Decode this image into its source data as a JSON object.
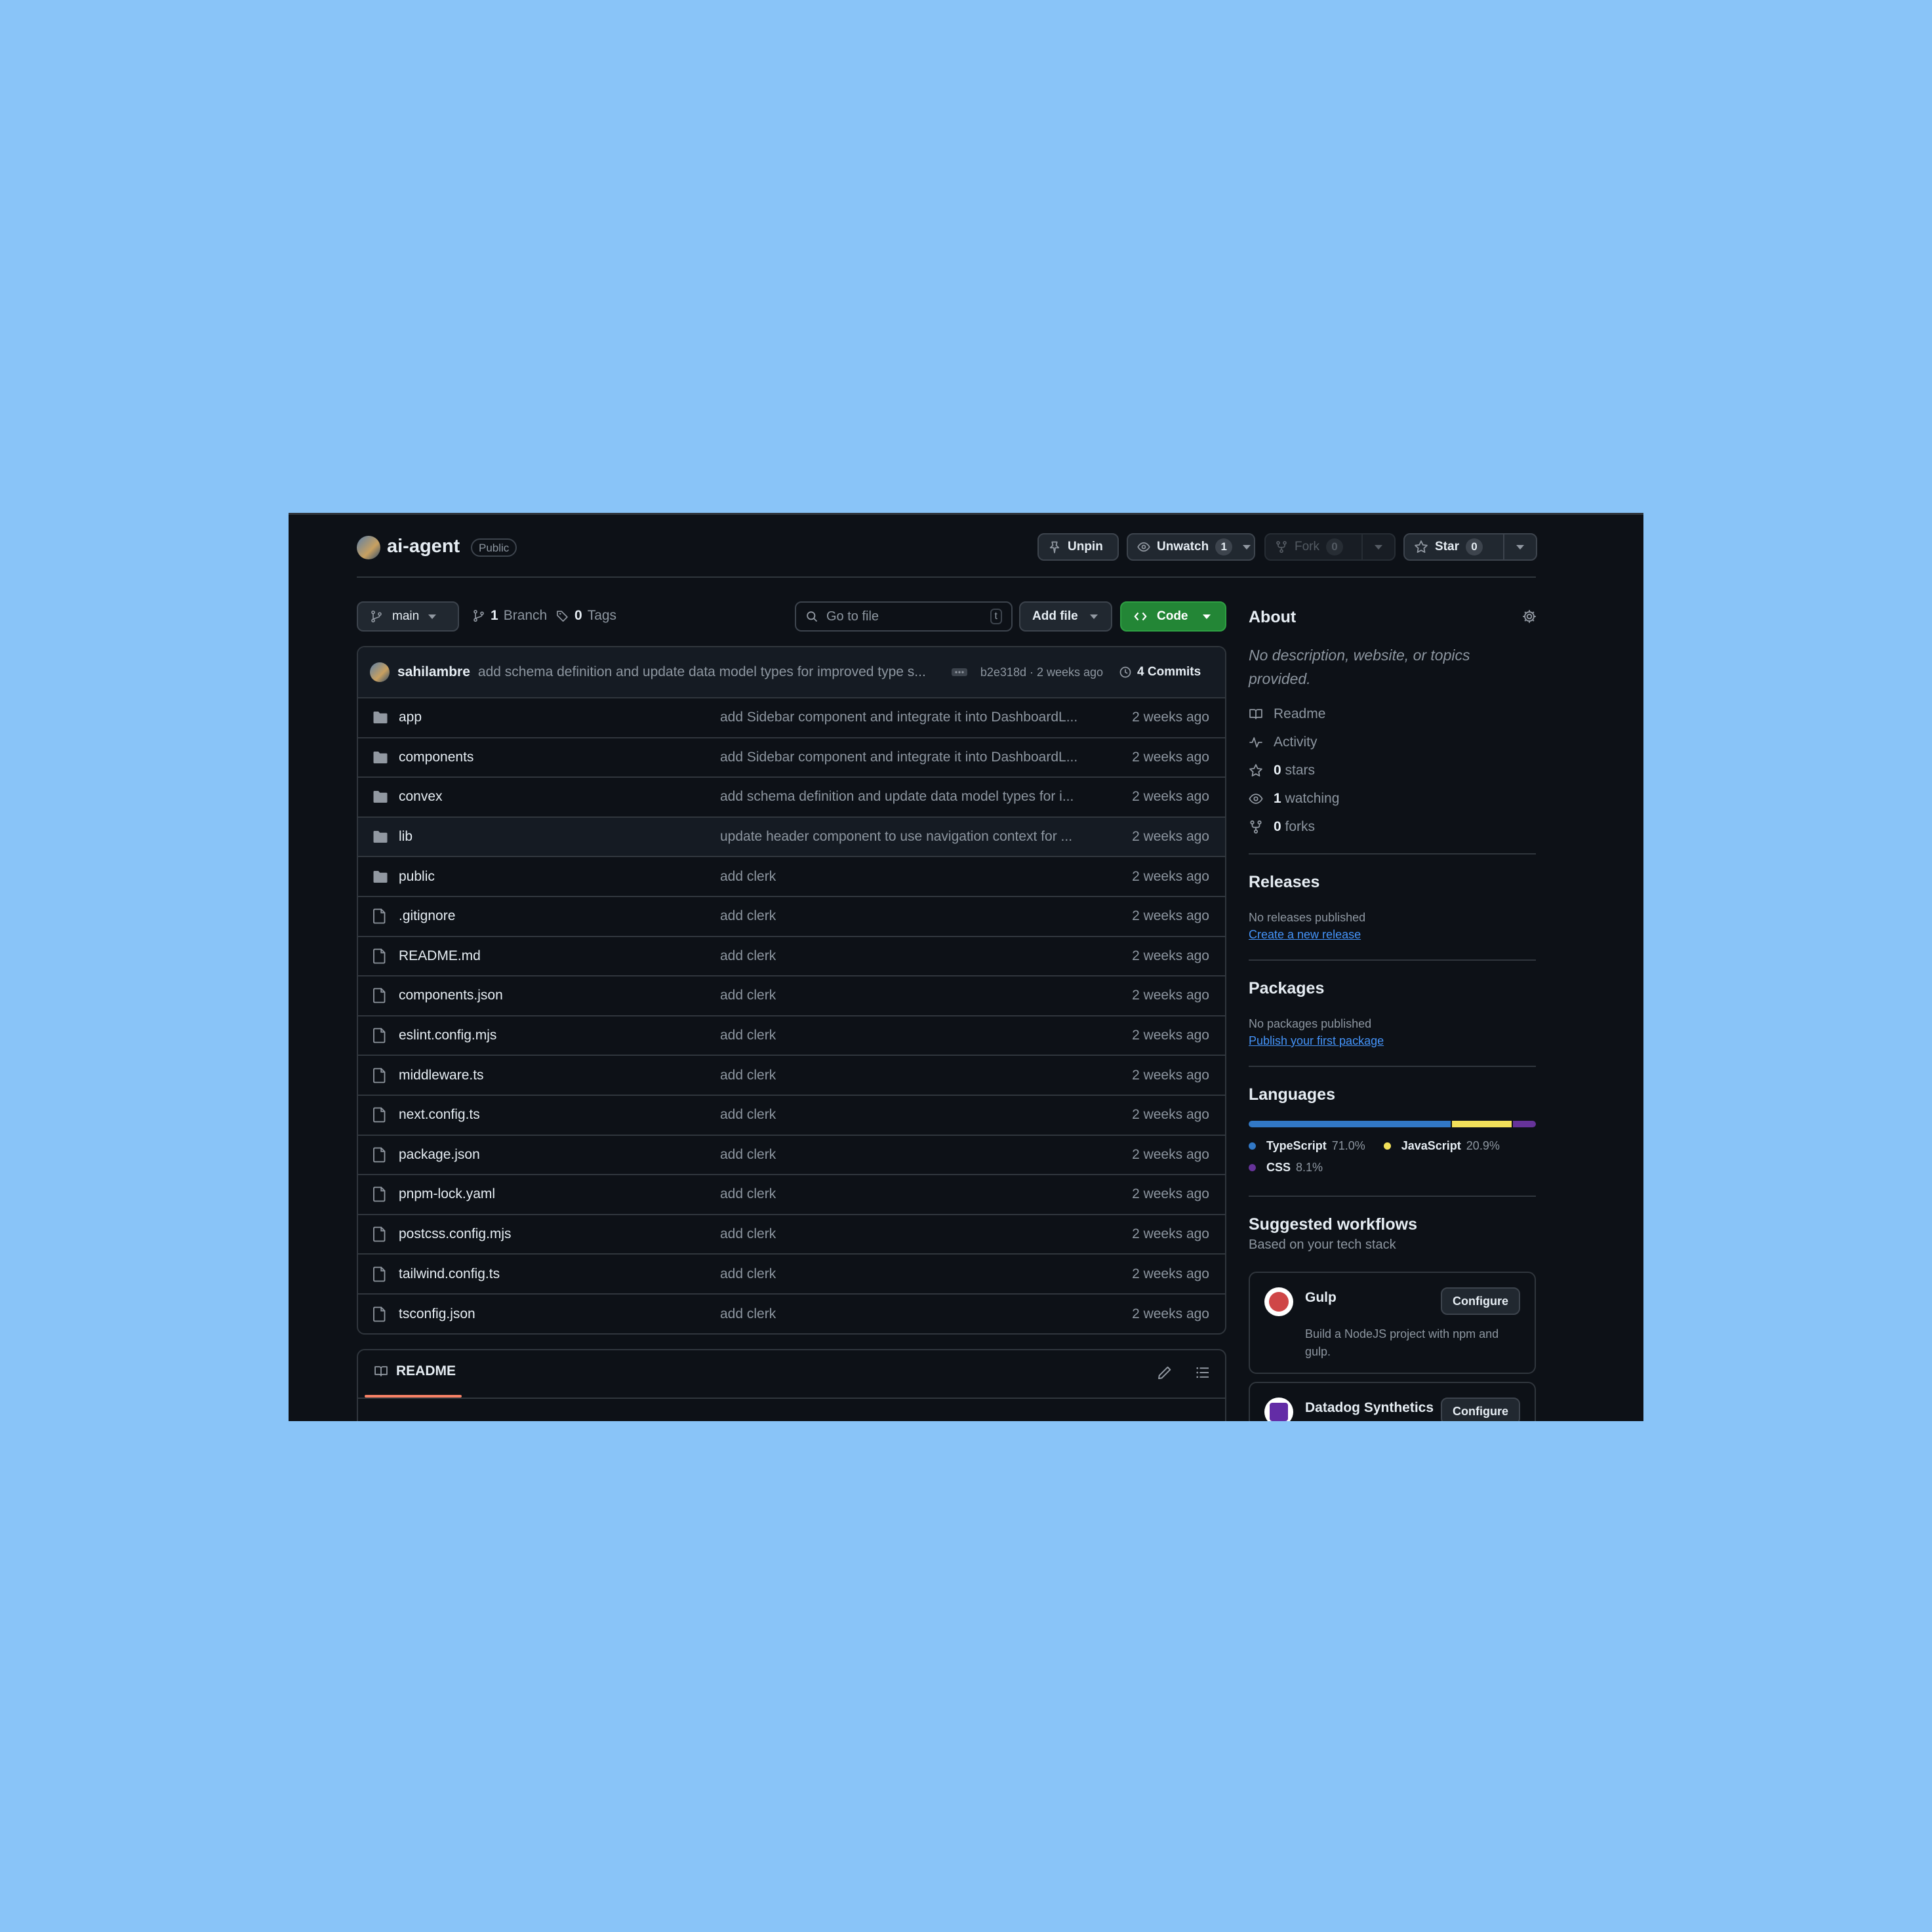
{
  "repo": {
    "name": "ai-agent",
    "visibility": "Public"
  },
  "actions": {
    "unpin": "Unpin",
    "unwatch": "Unwatch",
    "watch_count": "1",
    "fork": "Fork",
    "fork_count": "0",
    "star": "Star",
    "star_count": "0"
  },
  "toolbar": {
    "branch": "main",
    "branch_count": "1",
    "branch_label": "Branch",
    "tag_count": "0",
    "tag_label": "Tags",
    "search_placeholder": "Go to file",
    "search_key": "t",
    "add_file": "Add file",
    "code": "Code"
  },
  "commit": {
    "author": "sahilambre",
    "message": "add schema definition and update data model types for improved type s...",
    "hash_time": "b2e318d · 2 weeks ago",
    "count": "4 Commits"
  },
  "files": [
    {
      "name": "app",
      "type": "dir",
      "message": "add Sidebar component and integrate it into DashboardL...",
      "time": "2 weeks ago"
    },
    {
      "name": "components",
      "type": "dir",
      "message": "add Sidebar component and integrate it into DashboardL...",
      "time": "2 weeks ago"
    },
    {
      "name": "convex",
      "type": "dir",
      "message": "add schema definition and update data model types for i...",
      "time": "2 weeks ago"
    },
    {
      "name": "lib",
      "type": "dir",
      "message": "update header component to use navigation context for ...",
      "time": "2 weeks ago"
    },
    {
      "name": "public",
      "type": "dir",
      "message": "add clerk",
      "time": "2 weeks ago"
    },
    {
      "name": ".gitignore",
      "type": "file",
      "message": "add clerk",
      "time": "2 weeks ago"
    },
    {
      "name": "README.md",
      "type": "file",
      "message": "add clerk",
      "time": "2 weeks ago"
    },
    {
      "name": "components.json",
      "type": "file",
      "message": "add clerk",
      "time": "2 weeks ago"
    },
    {
      "name": "eslint.config.mjs",
      "type": "file",
      "message": "add clerk",
      "time": "2 weeks ago"
    },
    {
      "name": "middleware.ts",
      "type": "file",
      "message": "add clerk",
      "time": "2 weeks ago"
    },
    {
      "name": "next.config.ts",
      "type": "file",
      "message": "add clerk",
      "time": "2 weeks ago"
    },
    {
      "name": "package.json",
      "type": "file",
      "message": "add clerk",
      "time": "2 weeks ago"
    },
    {
      "name": "pnpm-lock.yaml",
      "type": "file",
      "message": "add clerk",
      "time": "2 weeks ago"
    },
    {
      "name": "postcss.config.mjs",
      "type": "file",
      "message": "add clerk",
      "time": "2 weeks ago"
    },
    {
      "name": "tailwind.config.ts",
      "type": "file",
      "message": "add clerk",
      "time": "2 weeks ago"
    },
    {
      "name": "tsconfig.json",
      "type": "file",
      "message": "add clerk",
      "time": "2 weeks ago"
    }
  ],
  "readme_tab": "README",
  "about": {
    "title": "About",
    "description": "No description, website, or topics provided.",
    "readme": "Readme",
    "activity": "Activity",
    "stars_count": "0",
    "stars_label": "stars",
    "watching_count": "1",
    "watching_label": "watching",
    "forks_count": "0",
    "forks_label": "forks"
  },
  "releases": {
    "title": "Releases",
    "none": "No releases published",
    "link": "Create a new release"
  },
  "packages": {
    "title": "Packages",
    "none": "No packages published",
    "link": "Publish your first package"
  },
  "languages": {
    "title": "Languages",
    "items": [
      {
        "name": "TypeScript",
        "percent": "71.0%",
        "value": 71.0,
        "color": "#3178c6"
      },
      {
        "name": "JavaScript",
        "percent": "20.9%",
        "value": 20.9,
        "color": "#f1e05a"
      },
      {
        "name": "CSS",
        "percent": "8.1%",
        "value": 8.1,
        "color": "#663399"
      }
    ]
  },
  "workflows": {
    "title": "Suggested workflows",
    "subtitle": "Based on your tech stack",
    "items": [
      {
        "name": "Gulp",
        "description": "Build a NodeJS project with npm and gulp.",
        "button": "Configure",
        "icon": "gulp-logo"
      },
      {
        "name": "Datadog Synthetics",
        "button": "Configure",
        "icon": "datadog-logo"
      }
    ]
  },
  "colors": {
    "background": "#89c4f8",
    "page": "#0d1117",
    "accent_green": "#238636",
    "link": "#4493f8",
    "readme_underline": "#f78166"
  }
}
